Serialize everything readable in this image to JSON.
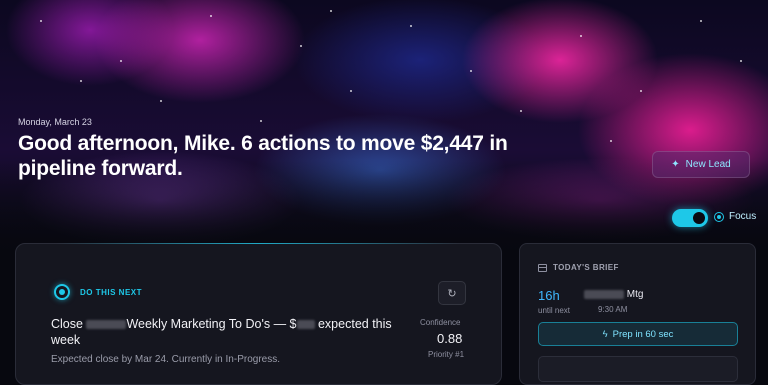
{
  "hero": {
    "date": "Monday, March 23",
    "headline": "Good afternoon, Mike. 6 actions to move $2,447 in pipeline forward.",
    "new_lead_label": "New Lead",
    "new_lead_icon": "sparkle-icon",
    "focus_label": "Focus",
    "focus_enabled": true
  },
  "next_action": {
    "section_label": "DO THIS NEXT",
    "title_prefix": "Close",
    "title_middle": "Weekly Marketing To Do's — $",
    "title_suffix": "expected this week",
    "subtitle": "Expected close by Mar 24. Currently in In-Progress.",
    "confidence_label": "Confidence",
    "confidence_value": "0.88",
    "priority": "Priority #1",
    "refresh_icon": "refresh-icon"
  },
  "brief": {
    "title": "TODAY'S BRIEF",
    "hours": "16h",
    "until_label": "until next",
    "meeting_suffix": "Mtg",
    "meeting_time": "9:30 AM",
    "prep_label": "Prep in 60 sec",
    "prep_icon": "lightning-icon"
  },
  "colors": {
    "accent": "#1ec8e8",
    "hours": "#3fb8ff",
    "card_bg": "#15161f"
  }
}
